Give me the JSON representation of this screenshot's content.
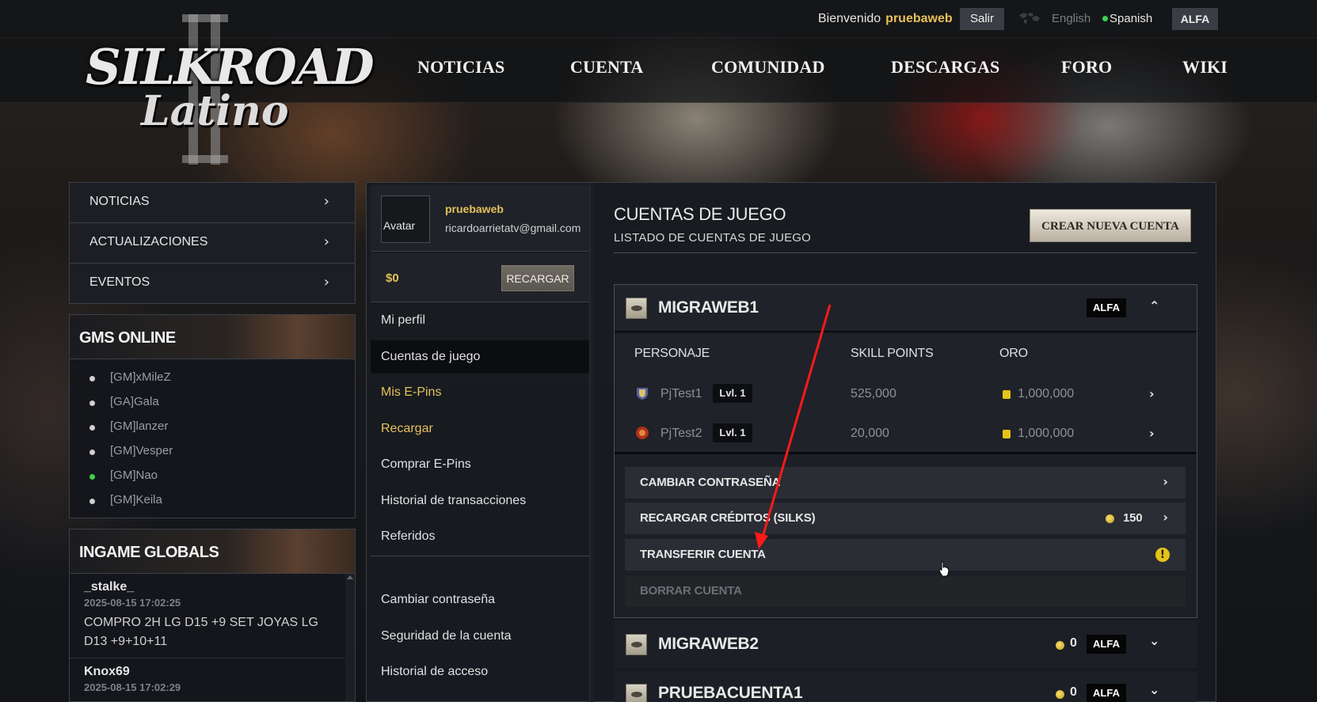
{
  "header": {
    "welcome_text": "Bienvenido",
    "username": "pruebaweb",
    "logout_label": "Salir",
    "languages": [
      "English",
      "Spanish"
    ],
    "active_language": "Spanish",
    "server": "ALFA",
    "logo_line1": "SILKROAD",
    "logo_line2": "Latino"
  },
  "nav": [
    "NOTICIAS",
    "CUENTA",
    "COMUNIDAD",
    "DESCARGAS",
    "FORO",
    "WIKI"
  ],
  "left_menu": [
    {
      "label": "NOTICIAS",
      "arrow": "›"
    },
    {
      "label": "ACTUALIZACIONES",
      "arrow": "›"
    },
    {
      "label": "EVENTOS",
      "arrow": "›"
    }
  ],
  "gms_online": {
    "title": "GMS ONLINE",
    "gms": [
      {
        "name": "[GM]xMileZ",
        "online": false
      },
      {
        "name": "[GA]Gala",
        "online": false
      },
      {
        "name": "[GM]lanzer",
        "online": false
      },
      {
        "name": "[GM]Vesper",
        "online": false
      },
      {
        "name": "[GM]Nao",
        "online": true
      },
      {
        "name": "[GM]Keila",
        "online": false
      }
    ]
  },
  "ingame_globals": {
    "title": "INGAME GLOBALS",
    "entries": [
      {
        "name": "_stalke_",
        "time": "2025-08-15 17:02:25",
        "message": "COMPRO 2H LG D15 +9 SET JOYAS LG D13 +9+10+11"
      },
      {
        "name": "Knox69",
        "time": "2025-08-15 17:02:29",
        "message": ""
      }
    ]
  },
  "profile": {
    "avatar_label": "Avatar",
    "name": "pruebaweb",
    "email": "ricardoarrietatv@gmail.com",
    "balance": "$0",
    "recharge_label": "RECARGAR"
  },
  "side_menu": [
    {
      "label": "Mi perfil",
      "gold": false,
      "active": false
    },
    {
      "label": "Cuentas de juego",
      "gold": false,
      "active": true
    },
    {
      "label": "Mis E-Pins",
      "gold": true,
      "active": false
    },
    {
      "label": "Recargar",
      "gold": true,
      "active": false
    },
    {
      "label": "Comprar E-Pins",
      "gold": false,
      "active": false
    },
    {
      "label": "Historial de transacciones",
      "gold": false,
      "active": false
    },
    {
      "label": "Referidos",
      "gold": false,
      "active": false
    }
  ],
  "side_menu_bottom": [
    {
      "label": "Cambiar contraseña"
    },
    {
      "label": "Seguridad de la cuenta"
    },
    {
      "label": "Historial de acceso"
    }
  ],
  "content": {
    "title": "CUENTAS DE JUEGO",
    "subtitle": "LISTADO DE CUENTAS DE JUEGO",
    "create_button": "CREAR NUEVA CUENTA"
  },
  "accounts": [
    {
      "name": "MIGRAWEB1",
      "server": "ALFA",
      "expanded": true,
      "columns": [
        "PERSONAJE",
        "SKILL POINTS",
        "ORO"
      ],
      "characters": [
        {
          "name": "PjTest1",
          "level": "Lvl. 1",
          "skill_points": "525,000",
          "gold": "1,000,000"
        },
        {
          "name": "PjTest2",
          "level": "Lvl. 1",
          "skill_points": "20,000",
          "gold": "1,000,000"
        }
      ],
      "actions": [
        {
          "label": "CAMBIAR CONTRASEÑA",
          "value": "",
          "icon": "chevron-right-icon",
          "disabled": false
        },
        {
          "label": "RECARGAR CRÉDITOS (SILKS)",
          "value": "150",
          "icon": "chevron-right-icon",
          "disabled": false
        },
        {
          "label": "TRANSFERIR CUENTA",
          "value": "",
          "icon": "warning-icon",
          "disabled": false
        },
        {
          "label": "BORRAR CUENTA",
          "value": "",
          "icon": "",
          "disabled": true
        }
      ]
    },
    {
      "name": "MIGRAWEB2",
      "server": "ALFA",
      "credits": "0",
      "expanded": false
    },
    {
      "name": "PRUEBACUENTA1",
      "server": "ALFA",
      "credits": "0",
      "expanded": false
    }
  ],
  "colors": {
    "accent_gold": "#e6c15a",
    "online_green": "#3ed14a",
    "annotation_red": "#ff1a1a"
  }
}
